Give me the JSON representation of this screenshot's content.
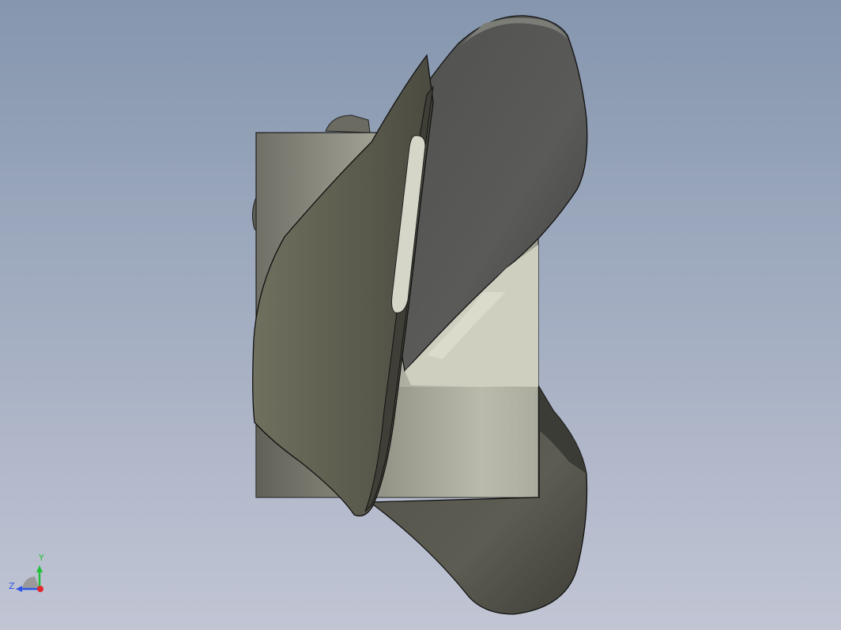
{
  "scene": {
    "model_description_icon": "propeller-3d-model",
    "background_top": "#8596ae",
    "background_bottom": "#c1c5d4"
  },
  "triad": {
    "y_label": "Y",
    "z_label": "Z",
    "y_color": "#22c03a",
    "z_color": "#2e56e6",
    "x_color": "#e0282e"
  }
}
